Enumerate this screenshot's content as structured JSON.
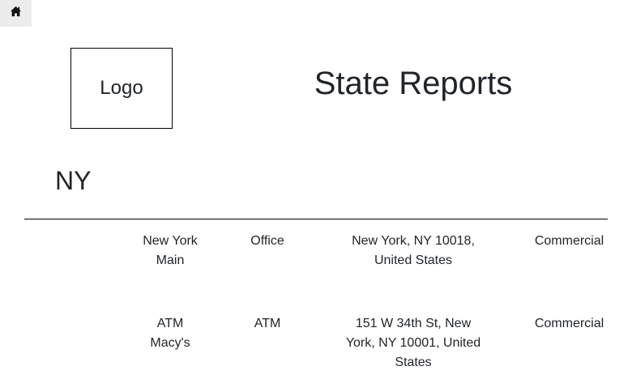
{
  "nav": {
    "home_icon": "home-icon"
  },
  "header": {
    "logo_text": "Logo",
    "title": "State Reports"
  },
  "state": {
    "name": "NY"
  },
  "locations": [
    {
      "name": "New York Main",
      "type": "Office",
      "address": "New York, NY 10018, United States",
      "category": "Commercial"
    },
    {
      "name": "ATM Macy's",
      "type": "ATM",
      "address": "151 W 34th St, New York, NY 10001, United States",
      "category": "Commercial"
    }
  ]
}
